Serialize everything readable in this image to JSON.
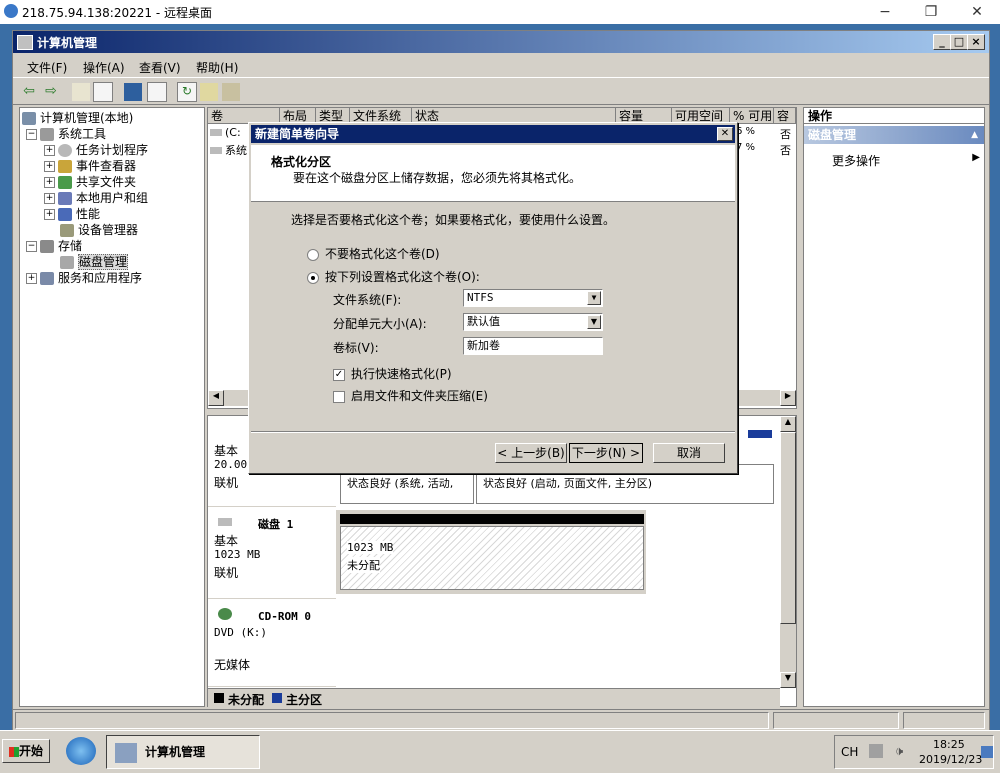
{
  "rdp": {
    "title": "218.75.94.138:20221 - 远程桌面",
    "minimize": "−",
    "maximize": "❐",
    "close": "✕"
  },
  "mmc": {
    "title": "计算机管理",
    "menu": [
      "文件(F)",
      "操作(A)",
      "查看(V)",
      "帮助(H)"
    ],
    "tree": {
      "root": "计算机管理(本地)",
      "system_tools": "系统工具",
      "task_scheduler": "任务计划程序",
      "event_viewer": "事件查看器",
      "shared_folders": "共享文件夹",
      "local_users": "本地用户和组",
      "performance": "性能",
      "device_manager": "设备管理器",
      "storage": "存储",
      "disk_management": "磁盘管理",
      "services_apps": "服务和应用程序"
    },
    "volume_columns": [
      "卷",
      "布局",
      "类型",
      "文件系统",
      "状态",
      "容量",
      "可用空间",
      "% 可用",
      "容"
    ],
    "volume_rows": [
      {
        "name": "(C:",
        "pct": "6 %",
        "tolerance": "否"
      },
      {
        "name": "系统",
        "pct": "7 %",
        "tolerance": "否"
      }
    ],
    "disk0": {
      "type": "基本",
      "size": "20.00",
      "status": "联机",
      "part1_status": "状态良好 (系统, 活动,",
      "part2_status": "状态良好 (启动, 页面文件, 主分区)"
    },
    "disk1": {
      "name": "磁盘 1",
      "type": "基本",
      "size": "1023 MB",
      "status": "联机",
      "part_size": "1023 MB",
      "part_status": "未分配"
    },
    "cdrom": {
      "name": "CD-ROM 0",
      "type": "DVD (K:)",
      "status": "无媒体"
    },
    "legend": {
      "unallocated": "未分配",
      "primary": "主分区"
    },
    "actions": {
      "header": "操作",
      "section": "磁盘管理",
      "more": "更多操作"
    }
  },
  "dialog": {
    "title": "新建简单卷向导",
    "close": "✕",
    "header_title": "格式化分区",
    "header_subtitle": "要在这个磁盘分区上储存数据，您必须先将其格式化。",
    "question": "选择是否要格式化这个卷；如果要格式化，要使用什么设置。",
    "opt_no_format": "不要格式化这个卷(D)",
    "opt_format": "按下列设置格式化这个卷(O):",
    "fs_label": "文件系统(F):",
    "fs_value": "NTFS",
    "alloc_label": "分配单元大小(A):",
    "alloc_value": "默认值",
    "volume_label": "卷标(V):",
    "volume_value": "新加卷",
    "quick_format": "执行快速格式化(P)",
    "compression": "启用文件和文件夹压缩(E)",
    "back_button": "< 上一步(B)",
    "next_button": "下一步(N) >",
    "cancel_button": "取消"
  },
  "taskbar": {
    "start": "开始",
    "task": "计算机管理",
    "lang": "CH",
    "time": "18:25",
    "date": "2019/12/23"
  }
}
